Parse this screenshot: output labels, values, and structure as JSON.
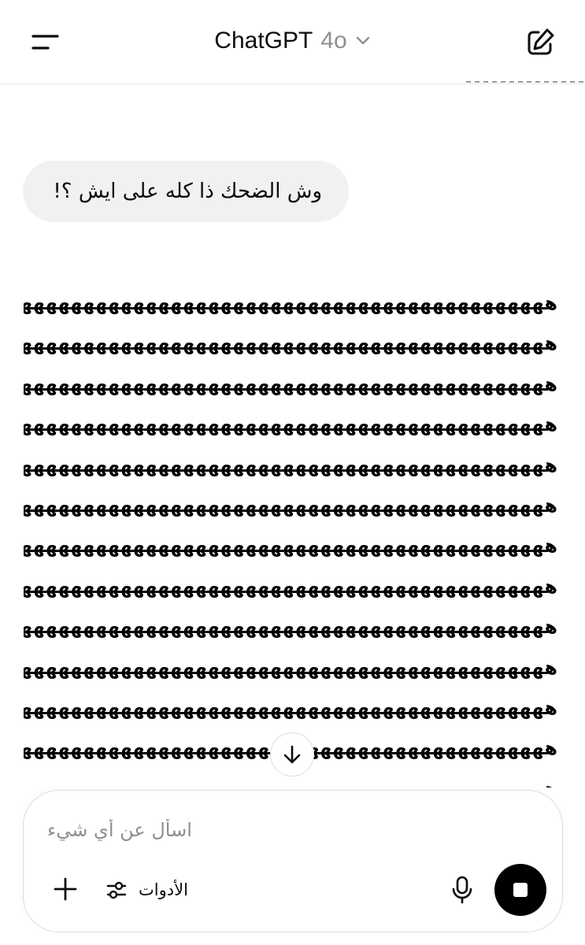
{
  "header": {
    "title": "ChatGPT",
    "model": "4o",
    "menu_icon": "hamburger-menu-icon",
    "dropdown_icon": "chevron-down-icon",
    "new_chat_icon": "edit-icon"
  },
  "conversation": {
    "user_message": "وش الضحك ذا كله على ايش ؟!",
    "assistant_lines": [
      "هههههههههههههههههههههههههههههههههههههههههههههههههههههههههههههههههههههههههههههههههههههههههههههههههههه",
      "هههههههههههههههههههههههههههههههههههههههههههههههههههههههههههههههههههههههههههههههههههههههههههههههههههه",
      "هههههههههههههههههههههههههههههههههههههههههههههههههههههههههههههههههههههههههههههههههههههههههههههههههههه",
      "هههههههههههههههههههههههههههههههههههههههههههههههههههههههههههههههههههههههههههههههههههههههههههههههههههه",
      "هههههههههههههههههههههههههههههههههههههههههههههههههههههههههههههههههههههههههههههههههههههههههههههههههههه",
      "هههههههههههههههههههههههههههههههههههههههههههههههههههههههههههههههههههههههههههههههههههههههههههههههههههه",
      "هههههههههههههههههههههههههههههههههههههههههههههههههههههههههههههههههههههههههههههههههههههههههههههههههههه",
      "هههههههههههههههههههههههههههههههههههههههههههههههههههههههههههههههههههههههههههههههههههههههههههههههههههه",
      "هههههههههههههههههههههههههههههههههههههههههههههههههههههههههههههههههههههههههههههههههههههههههههههههههههه",
      "هههههههههههههههههههههههههههههههههههههههههههههههههههههههههههههههههههههههههههههههههههههههههههههههههههه",
      "هههههههههههههههههههههههههههههههههههههههههههههههههههههههههههههههههههههههههههههههههههههههههههههههههههه",
      "هههههههههههههههههههههههههههههههههههههههههههههههههههههههههههههههههههههههههههههههههههههههههههههههههههه",
      "هههههههههههههههههههههههههههههههههههههههههههههههههههههههههههههههههههههههههههههههههههههههههههههههههههه"
    ],
    "scroll_icon": "arrow-down-icon"
  },
  "composer": {
    "placeholder": "اسأل عن أي شيء",
    "tools_label": "الأدوات",
    "add_icon": "plus-icon",
    "tools_icon": "sliders-icon",
    "mic_icon": "microphone-icon",
    "stop_icon": "stop-icon"
  },
  "colors": {
    "background": "#ffffff",
    "text": "#0d0d0d",
    "muted_text": "#8f8f8f",
    "bubble": "#f1f1f1",
    "border": "#dcdcdc",
    "stop_button": "#000000"
  }
}
